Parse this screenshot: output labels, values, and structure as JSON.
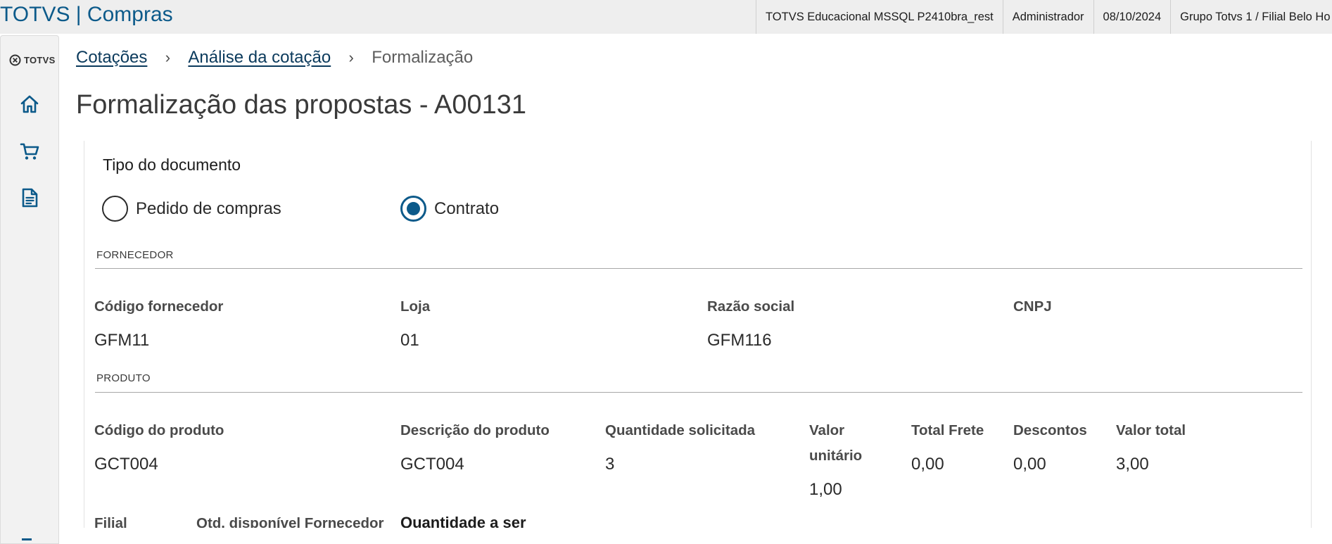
{
  "topbar": {
    "title": "TOTVS | Compras",
    "environment": "TOTVS Educacional MSSQL P2410bra_rest",
    "user": "Administrador",
    "date": "08/10/2024",
    "branch": "Grupo Totvs 1 / Filial Belo Ho"
  },
  "sidebar": {
    "brand": "TOTVS",
    "items": [
      {
        "icon": "home-icon"
      },
      {
        "icon": "shopping-cart-icon"
      },
      {
        "icon": "document-icon"
      }
    ]
  },
  "breadcrumb": {
    "items": [
      {
        "label": "Cotações"
      },
      {
        "label": "Análise da cotação"
      },
      {
        "label": "Formalização"
      }
    ]
  },
  "page": {
    "title": "Formalização das propostas - A00131"
  },
  "document_type": {
    "label": "Tipo do documento",
    "options": [
      {
        "label": "Pedido de compras",
        "checked": false
      },
      {
        "label": "Contrato",
        "checked": true
      }
    ]
  },
  "fornecedor": {
    "section": "FORNECEDOR",
    "fields": [
      {
        "label": "Código fornecedor",
        "value": "GFM11"
      },
      {
        "label": "Loja",
        "value": "01"
      },
      {
        "label": "Razão social",
        "value": "GFM116"
      },
      {
        "label": "CNPJ",
        "value": ""
      }
    ]
  },
  "produto": {
    "section": "PRODUTO",
    "fields": [
      {
        "label": "Código do produto",
        "value": "GCT004"
      },
      {
        "label": "Descrição do produto",
        "value": "GCT004"
      },
      {
        "label": "Quantidade solicitada",
        "value": "3"
      },
      {
        "label": "Valor unitário",
        "value": "1,00"
      },
      {
        "label": "Total Frete",
        "value": "0,00"
      },
      {
        "label": "Descontos",
        "value": "0,00"
      },
      {
        "label": "Valor total",
        "value": "3,00"
      }
    ]
  },
  "filial_section": {
    "fields": [
      {
        "label": "Filial"
      },
      {
        "label": "Qtd. disponível Fornecedor"
      },
      {
        "label": "Quantidade a ser"
      }
    ]
  },
  "colors": {
    "primary": "#0c5a8a",
    "breadcrumb_link": "#0b3a5c",
    "topbar_bg": "#eeeeee",
    "sidebar_bg": "#f2f2f2"
  }
}
